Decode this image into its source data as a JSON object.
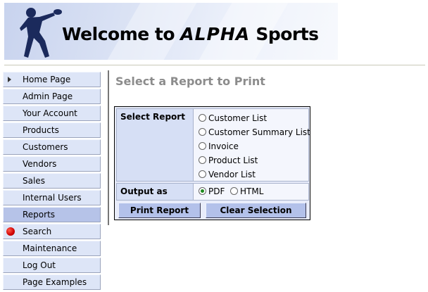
{
  "banner": {
    "title_prefix": "Welcome to ",
    "brand": "ALPHA",
    "title_suffix": " Sports"
  },
  "sidebar": {
    "items": [
      {
        "label": "Home Page",
        "icon": "arrow-icon"
      },
      {
        "label": "Admin Page"
      },
      {
        "label": "Your Account"
      },
      {
        "label": "Products"
      },
      {
        "label": "Customers"
      },
      {
        "label": "Vendors"
      },
      {
        "label": "Sales"
      },
      {
        "label": "Internal Users"
      },
      {
        "label": "Reports",
        "active": true
      },
      {
        "label": "Search",
        "icon": "red-dot-icon"
      },
      {
        "label": "Maintenance"
      },
      {
        "label": "Log Out"
      },
      {
        "label": "Page Examples"
      }
    ]
  },
  "main": {
    "title": "Select a Report to Print",
    "select_report_label": "Select Report",
    "reports": [
      "Customer List",
      "Customer Summary List",
      "Invoice",
      "Product List",
      "Vendor List"
    ],
    "output_label": "Output as",
    "output_options": [
      "PDF",
      "HTML"
    ],
    "output_selected": "PDF",
    "print_button": "Print Report",
    "clear_button": "Clear Selection"
  },
  "colors": {
    "accent": "#b3c1ea",
    "nav_bg": "#dde5f7",
    "nav_active": "#b6c3e8",
    "title_gray": "#8c8c8c"
  }
}
